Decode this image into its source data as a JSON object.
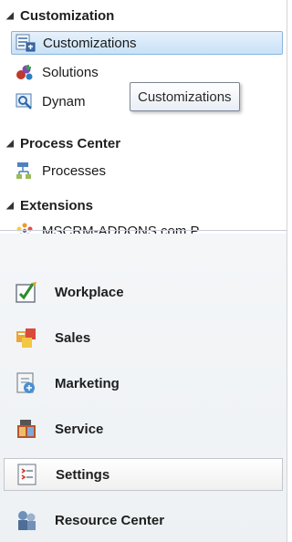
{
  "groups": [
    {
      "title": "Customization",
      "items": [
        {
          "label": "Customizations",
          "icon": "customizations-icon"
        },
        {
          "label": "Solutions",
          "icon": "solutions-icon"
        },
        {
          "label": "Dynam",
          "icon": "dynamics-marketplace-icon"
        }
      ]
    },
    {
      "title": "Process Center",
      "items": [
        {
          "label": "Processes",
          "icon": "processes-icon"
        }
      ]
    },
    {
      "title": "Extensions",
      "items": [
        {
          "label": "MSCRM-ADDONS.com P...",
          "icon": "addons-icon"
        }
      ]
    }
  ],
  "tooltip": {
    "text": "Customizations"
  },
  "areas": [
    {
      "label": "Workplace",
      "icon": "workplace-icon"
    },
    {
      "label": "Sales",
      "icon": "sales-icon"
    },
    {
      "label": "Marketing",
      "icon": "marketing-icon"
    },
    {
      "label": "Service",
      "icon": "service-icon"
    },
    {
      "label": "Settings",
      "icon": "settings-icon"
    },
    {
      "label": "Resource Center",
      "icon": "resource-center-icon"
    }
  ],
  "selected": {
    "tree_item": "Customizations",
    "area": "Settings"
  },
  "colors": {
    "selection_border": "#8bb6de",
    "selection_fill": "#c9e2f7",
    "divider": "#c9cfd6"
  }
}
